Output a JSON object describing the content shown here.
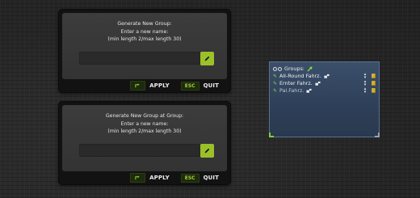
{
  "dialogs": [
    {
      "title": "Generate New Group:",
      "prompt": "Enter a new name:",
      "constraint": "(min length 2/max length 30)",
      "input_value": "",
      "apply_label": "APPLY",
      "esc_label": "ESC",
      "quit_label": "QUIT"
    },
    {
      "title": "Generate New Group at Group:",
      "prompt": "Enter a new name:",
      "constraint": "(min length 2/max length 30)",
      "input_value": "",
      "apply_label": "APPLY",
      "esc_label": "ESC",
      "quit_label": "QUIT"
    }
  ],
  "groups_panel": {
    "header": "Groups:",
    "items": [
      {
        "label": "All-Round Fahrz."
      },
      {
        "label": "Ernter Fahrz."
      },
      {
        "label": "Pal.Fahrz."
      }
    ]
  },
  "colors": {
    "accent_green": "#9bc02a",
    "panel_blue": "#34475f"
  },
  "icons": {
    "edit": "pencil-icon",
    "apply": "apply-arrow-icon",
    "vehicle": "vehicle-icon",
    "reorder": "up-down-arrows-icon",
    "fuel": "fuel-can-icon"
  }
}
